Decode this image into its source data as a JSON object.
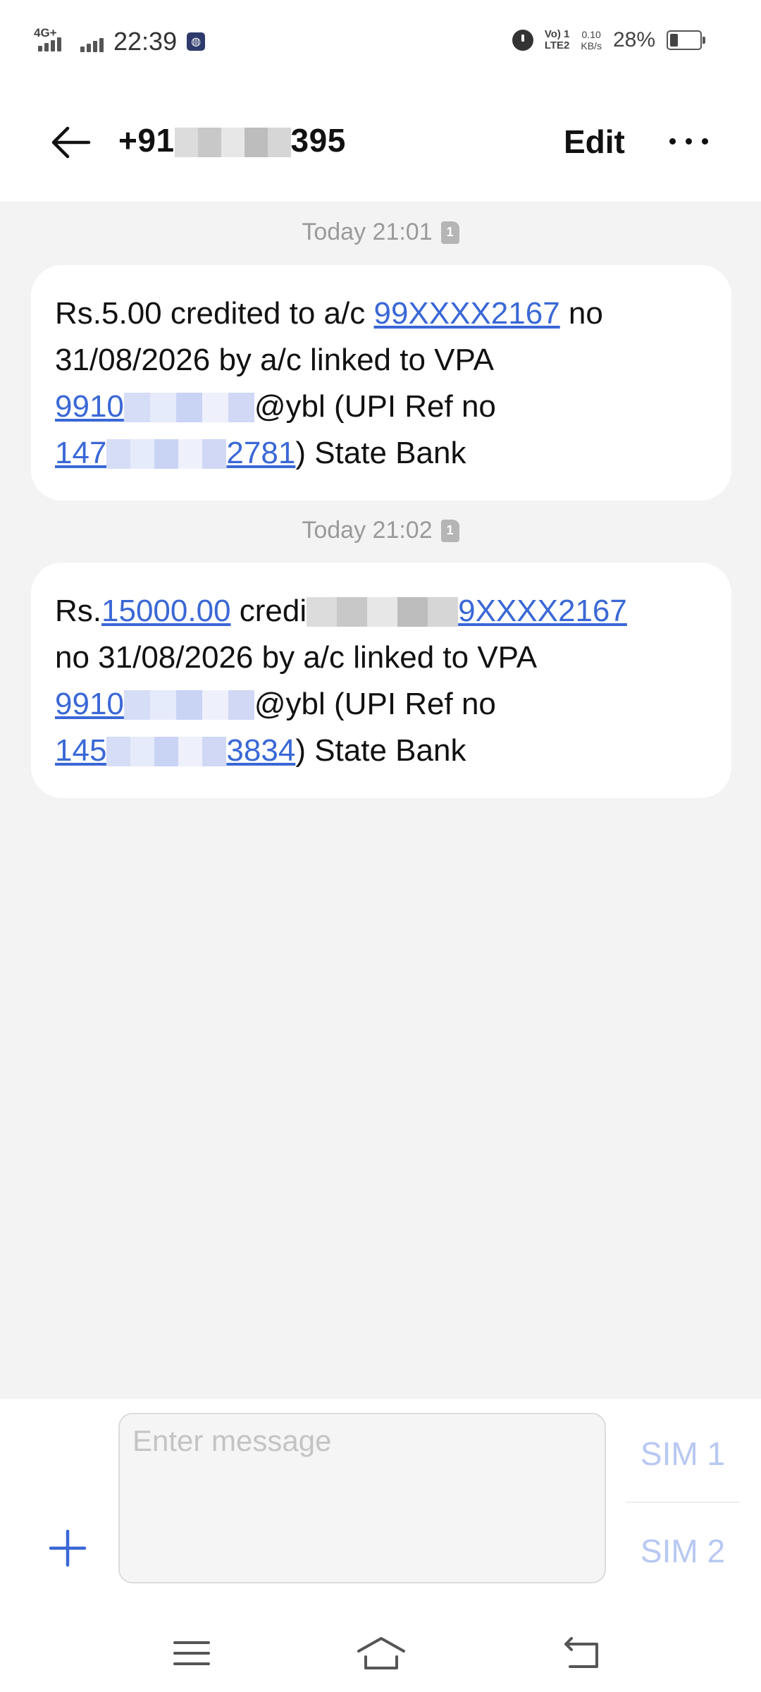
{
  "status_bar": {
    "network_type": "4G+",
    "time": "22:39",
    "volte_line1": "Vo) 1",
    "volte_line2": "LTE2",
    "speed_value": "0.10",
    "speed_unit": "KB/s",
    "battery_percent": "28%",
    "battery_level": 0.28,
    "icons": [
      "signal-icon",
      "signal-icon",
      "app-notification-icon",
      "alarm-icon",
      "volte-icon",
      "battery-icon"
    ]
  },
  "header": {
    "contact": "+91███████395",
    "contact_prefix": "+91",
    "contact_suffix": "395",
    "edit_label": "Edit",
    "back_icon": "arrow-left-icon",
    "more_icon": "more-horizontal-icon"
  },
  "messages": [
    {
      "timestamp": "Today 21:01",
      "sim": "1",
      "amount_prefix": "Rs.5.00 credited to a/c ",
      "account_link": "99XXXX2167",
      "line2": " no 31/08/2026 by a/c linked  to VPA",
      "vpa_prefix": "9910",
      "vpa_suffix": "@ybl",
      "ref_label": " (UPI Ref no",
      "ref_prefix": "147",
      "ref_suffix": "2781",
      "closing": ") State  Bank"
    },
    {
      "timestamp": "Today 21:02",
      "sim": "1",
      "amount_prefix": "Rs.",
      "amount_link": "15000.00",
      "amount_text": " credi",
      "account_link_suffix": "9XXXX2167",
      "line2": "no  31/08/2026 by a/c linked  to VPA",
      "vpa_prefix": "9910",
      "vpa_suffix": "@ybl",
      "ref_label": " (UPI Ref no",
      "ref_prefix": "145",
      "ref_suffix": "3834",
      "closing": ") State  Bank"
    }
  ],
  "composer": {
    "placeholder": "Enter message",
    "sim1_label": "SIM 1",
    "sim2_label": "SIM 2",
    "add_icon": "plus-icon"
  },
  "nav_bar": {
    "icons": [
      "menu-icon",
      "home-icon",
      "back-icon"
    ]
  }
}
